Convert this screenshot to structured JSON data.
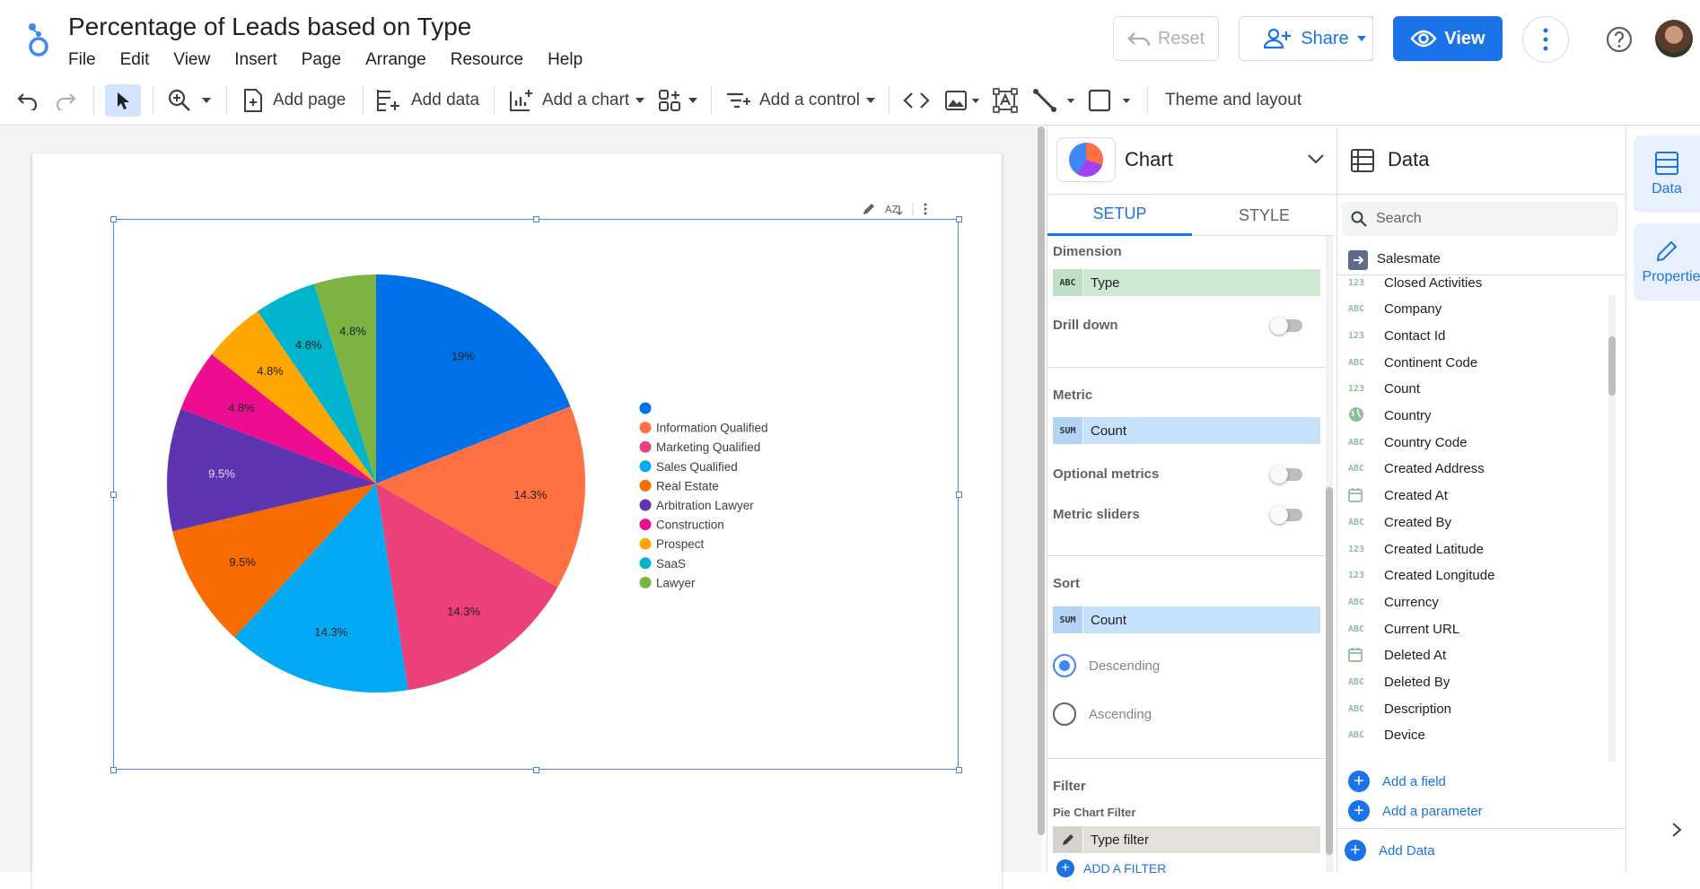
{
  "header": {
    "title": "Percentage of Leads based on Type",
    "menu": [
      "File",
      "Edit",
      "View",
      "Insert",
      "Page",
      "Arrange",
      "Resource",
      "Help"
    ],
    "reset_label": "Reset",
    "share_label": "Share",
    "view_label": "View"
  },
  "toolbar": {
    "add_page": "Add page",
    "add_data": "Add data",
    "add_chart": "Add a chart",
    "add_control": "Add a control",
    "theme_layout": "Theme and layout"
  },
  "chart_data": {
    "type": "pie",
    "categories": [
      "",
      "Information Qualified",
      "Marketing Qualified",
      "Sales Qualified",
      "Real Estate",
      "Arbitration Lawyer",
      "Construction",
      "Prospect",
      "SaaS",
      "Lawyer"
    ],
    "values": [
      19,
      14.3,
      14.3,
      14.3,
      9.5,
      9.5,
      4.8,
      4.8,
      4.8,
      4.8
    ],
    "labels": [
      "19%",
      "14.3%",
      "14.3%",
      "14.3%",
      "9.5%",
      "9.5%",
      "4.8%",
      "4.8%",
      "4.8%",
      "4.8%"
    ],
    "colors": [
      "#0072e9",
      "#ff7043",
      "#ec407a",
      "#03a9f4",
      "#f76c00",
      "#5e35b1",
      "#ec0d91",
      "#ffa600",
      "#00b4cc",
      "#7cb342"
    ],
    "legend": "right"
  },
  "props": {
    "title": "Chart",
    "tabs": [
      "SETUP",
      "STYLE"
    ],
    "dimension_title": "Dimension",
    "dimension_tag": "ABC",
    "dimension_value": "Type",
    "drill_down": "Drill down",
    "metric_title": "Metric",
    "metric_tag": "SUM",
    "metric_value": "Count",
    "optional_metrics": "Optional metrics",
    "metric_sliders": "Metric sliders",
    "sort_title": "Sort",
    "sort_tag": "SUM",
    "sort_value": "Count",
    "descending": "Descending",
    "ascending": "Ascending",
    "filter_title": "Filter",
    "filter_sub": "Pie Chart Filter",
    "filter_value": "Type filter",
    "add_filter": "ADD A FILTER"
  },
  "data_panel": {
    "title": "Data",
    "search_placeholder": "Search",
    "source": "Salesmate",
    "fields": [
      {
        "type": "123",
        "name": "Closed Activities"
      },
      {
        "type": "ABC",
        "name": "Company"
      },
      {
        "type": "123",
        "name": "Contact Id"
      },
      {
        "type": "ABC",
        "name": "Continent Code"
      },
      {
        "type": "123",
        "name": "Count"
      },
      {
        "type": "globe",
        "name": "Country"
      },
      {
        "type": "ABC",
        "name": "Country Code"
      },
      {
        "type": "ABC",
        "name": "Created Address"
      },
      {
        "type": "date",
        "name": "Created At"
      },
      {
        "type": "ABC",
        "name": "Created By"
      },
      {
        "type": "123",
        "name": "Created Latitude"
      },
      {
        "type": "123",
        "name": "Created Longitude"
      },
      {
        "type": "ABC",
        "name": "Currency"
      },
      {
        "type": "ABC",
        "name": "Current URL"
      },
      {
        "type": "date",
        "name": "Deleted At"
      },
      {
        "type": "ABC",
        "name": "Deleted By"
      },
      {
        "type": "ABC",
        "name": "Description"
      },
      {
        "type": "ABC",
        "name": "Device"
      }
    ],
    "add_field": "Add a field",
    "add_parameter": "Add a parameter",
    "add_data": "Add Data"
  },
  "rail": {
    "data_label": "Data",
    "properties_label": "Properties"
  }
}
